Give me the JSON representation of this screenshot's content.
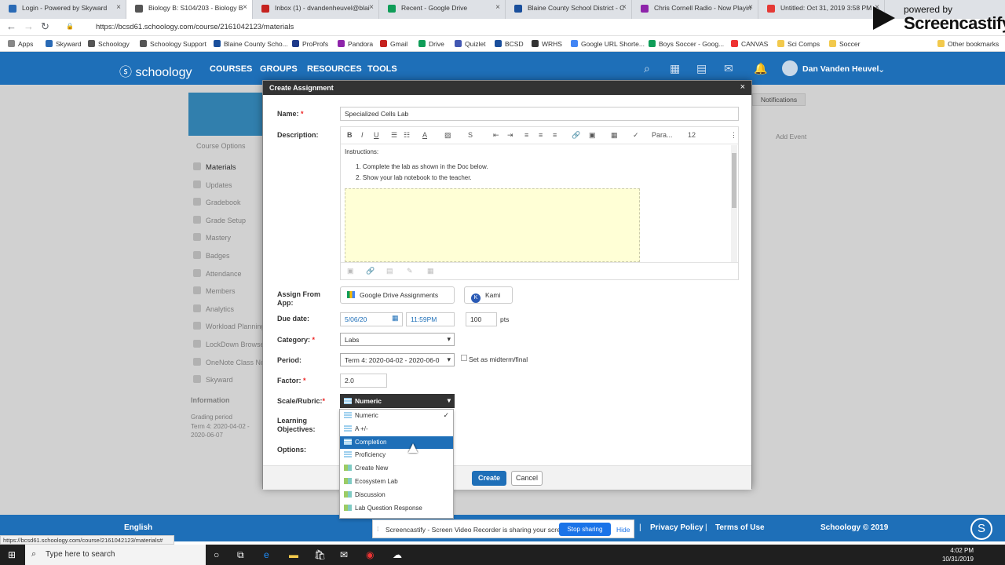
{
  "browser": {
    "tabs": [
      {
        "label": "Login - Powered by Skyward",
        "color": "#2a6ab5"
      },
      {
        "label": "Biology B: S104/203 - Biology B",
        "color": "#555"
      },
      {
        "label": "Inbox (1) - dvandenheuvel@blai",
        "color": "#c5221f"
      },
      {
        "label": "Recent - Google Drive",
        "color": "#0f9d58"
      },
      {
        "label": "Blaine County School District - C",
        "color": "#1a4f9c"
      },
      {
        "label": "Chris Cornell Radio - Now Playin",
        "color": "#8e24aa"
      },
      {
        "label": "Untitled: Oct 31, 2019 3:58 PM -",
        "color": "#e53935"
      }
    ],
    "url": "https://bcsd61.schoology.com/course/2161042123/materials",
    "bookmarks": [
      "Apps",
      "Skyward",
      "Schoology",
      "Schoology Support",
      "Blaine County Scho...",
      "ProProfs",
      "Pandora",
      "Gmail",
      "Drive",
      "Quizlet",
      "BCSD",
      "WRHS",
      "Google URL Shorte...",
      "Boys Soccer - Goog...",
      "CANVAS",
      "Sci Comps",
      "Soccer"
    ],
    "other_bookmarks": "Other bookmarks"
  },
  "screencastify_logo": {
    "powered_by": "powered by",
    "name": "Screencastify"
  },
  "nav": {
    "logo": "ⓢ schoology",
    "menu": [
      "COURSES",
      "GROUPS",
      "RESOURCES",
      "TOOLS"
    ],
    "user": "Dan Vanden Heuvel",
    "notif_count": "1"
  },
  "sidebar": {
    "course_options": "Course Options",
    "items": [
      "Materials",
      "Updates",
      "Gradebook",
      "Grade Setup",
      "Mastery",
      "Badges",
      "Attendance",
      "Members",
      "Analytics",
      "Workload Planning",
      "LockDown Browser",
      "OneNote Class No",
      "Skyward"
    ],
    "info_title": "Information",
    "grading_period_label": "Grading period",
    "grading_period_value": "Term 4: 2020-04-02 - 2020-06-07"
  },
  "right": {
    "notifications": "Notifications",
    "add_event": "Add Event"
  },
  "modal": {
    "title": "Create Assignment",
    "close": "×",
    "name_label": "Name:",
    "name_value": "Specialized Cells Lab",
    "description_label": "Description:",
    "editor": {
      "paragraph": "Para...",
      "font_size": "12",
      "instructions": "Instructions:",
      "steps": [
        "Complete the lab as shown in the Doc below.",
        "Show your lab notebook to the teacher."
      ]
    },
    "assign_from_label": "Assign From App:",
    "google_drive_btn": "Google Drive Assignments",
    "kami_btn": "Kami",
    "due_label": "Due date:",
    "due_date": "5/06/20",
    "due_time": "11:59PM",
    "points": "100",
    "pts": "pts",
    "category_label": "Category:",
    "category_value": "Labs",
    "period_label": "Period:",
    "period_value": "Term 4: 2020-04-02 - 2020-06-0",
    "midterm_label": "Set as midterm/final",
    "factor_label": "Factor:",
    "factor_value": "2.0",
    "scale_label": "Scale/Rubric:",
    "scale_value": "Numeric",
    "learning_label": "Learning Objectives:",
    "options_label": "Options:",
    "create": "Create",
    "cancel": "Cancel",
    "dropdown": [
      {
        "label": "Numeric",
        "icon": "lines",
        "checked": true,
        "highlight": false
      },
      {
        "label": "A +/-",
        "icon": "lines",
        "checked": false,
        "highlight": false
      },
      {
        "label": "Completion",
        "icon": "lines",
        "checked": false,
        "highlight": true
      },
      {
        "label": "Proficiency",
        "icon": "lines",
        "checked": false,
        "highlight": false
      },
      {
        "label": "Create New",
        "icon": "grid",
        "checked": false,
        "highlight": false
      },
      {
        "label": "Ecosystem Lab",
        "icon": "grid",
        "checked": false,
        "highlight": false
      },
      {
        "label": "Discussion",
        "icon": "grid",
        "checked": false,
        "highlight": false
      },
      {
        "label": "Lab Question Response",
        "icon": "grid",
        "checked": false,
        "highlight": false
      }
    ]
  },
  "footer": {
    "english": "English",
    "privacy": "Privacy Policy",
    "terms": "Terms of Use",
    "copyright": "Schoology © 2019"
  },
  "screencastify_bar": {
    "text": "Screencastify - Screen Video Recorder is sharing your screen.",
    "stop": "Stop sharing",
    "hide": "Hide"
  },
  "status_url": "https://bcsd61.schoology.com/course/2161042123/materials#",
  "taskbar": {
    "search": "Type here to search",
    "time": "4:02 PM",
    "date": "10/31/2019"
  }
}
